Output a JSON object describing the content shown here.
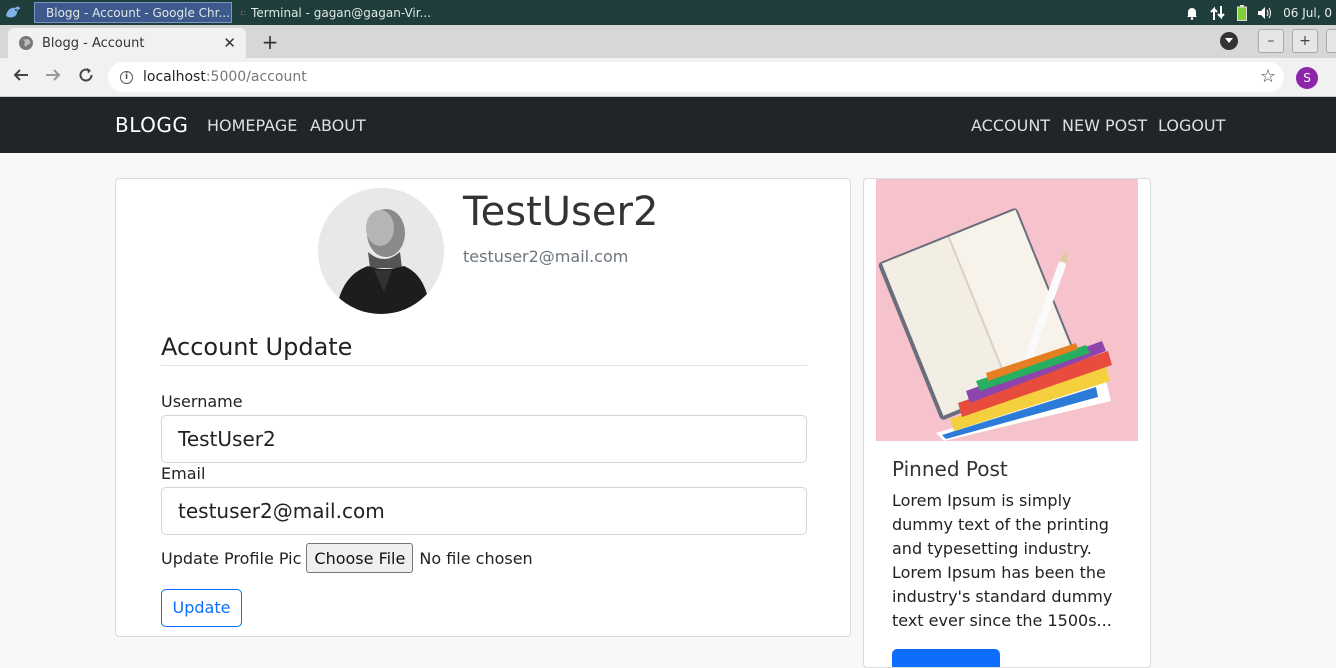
{
  "taskbar": {
    "items": [
      {
        "label": "Blogg - Account - Google Chr...",
        "active": true
      },
      {
        "label": "Terminal - gagan@gagan-Vir...",
        "active": false
      }
    ],
    "clock": "06 Jul, 0"
  },
  "browser": {
    "tab_title": "Blogg - Account",
    "url_host": "localhost",
    "url_path": ":5000/account",
    "profile_initial": "S"
  },
  "site_nav": {
    "brand": "BLOGG",
    "left_links": [
      "HOMEPAGE",
      "ABOUT"
    ],
    "right_links": [
      "ACCOUNT",
      "NEW POST",
      "LOGOUT"
    ]
  },
  "account": {
    "username": "TestUser2",
    "email": "testuser2@mail.com",
    "legend": "Account Update",
    "username_label": "Username",
    "username_value": "TestUser2",
    "email_label": "Email",
    "email_value": "testuser2@mail.com",
    "picture_label": "Update Profile Pic",
    "file_button": "Choose File",
    "file_status": "No file chosen",
    "update_button": "Update"
  },
  "pinned": {
    "title": "Pinned Post",
    "text": "Lorem Ipsum is simply dummy text of the printing and typesetting industry. Lorem Ipsum has been the industry's standard dummy text ever since the 1500s..."
  },
  "colors": {
    "navbar_bg": "#212529",
    "accent": "#0d6efd",
    "taskbar_bg": "#1f3d3a"
  }
}
